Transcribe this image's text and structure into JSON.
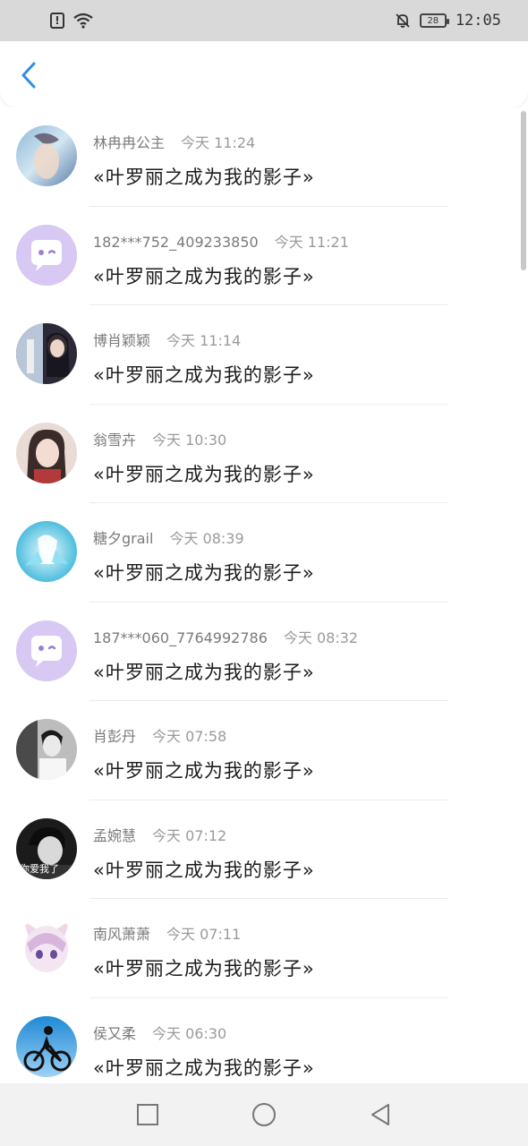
{
  "status_bar": {
    "battery": "28",
    "time": "12:05",
    "icons": [
      "alert-icon",
      "wifi-icon",
      "bell-off-icon",
      "battery-icon"
    ]
  },
  "header": {
    "back_icon": "chevron-left-icon",
    "accent": "#2d8ee8"
  },
  "comments": [
    {
      "username": "林冉冉公主",
      "time": "今天 11:24",
      "text": "«叶罗丽之成为我的影子»",
      "avatar": "photo-avatar"
    },
    {
      "username": "182***752_409233850",
      "time": "今天 11:21",
      "text": "«叶罗丽之成为我的影子»",
      "avatar": "default-chat-avatar"
    },
    {
      "username": "博肖颖颖",
      "time": "今天 11:14",
      "text": "«叶罗丽之成为我的影子»",
      "avatar": "photo-avatar"
    },
    {
      "username": "翁雪卉",
      "time": "今天 10:30",
      "text": "«叶罗丽之成为我的影子»",
      "avatar": "photo-avatar"
    },
    {
      "username": "糖夕grail",
      "time": "今天 08:39",
      "text": "«叶罗丽之成为我的影子»",
      "avatar": "photo-avatar"
    },
    {
      "username": "187***060_7764992786",
      "time": "今天 08:32",
      "text": "«叶罗丽之成为我的影子»",
      "avatar": "default-chat-avatar"
    },
    {
      "username": "肖彭丹",
      "time": "今天 07:58",
      "text": "«叶罗丽之成为我的影子»",
      "avatar": "photo-avatar"
    },
    {
      "username": "孟婉慧",
      "time": "今天 07:12",
      "text": "«叶罗丽之成为我的影子»",
      "avatar": "photo-avatar",
      "avatar_caption": "你爱我了"
    },
    {
      "username": "南风萧萧",
      "time": "今天 07:11",
      "text": "«叶罗丽之成为我的影子»",
      "avatar": "photo-avatar"
    },
    {
      "username": "侯又柔",
      "time": "今天 06:30",
      "text": "«叶罗丽之成为我的影子»",
      "avatar": "photo-avatar"
    }
  ],
  "nav_bar": {
    "buttons": [
      "recent-apps-icon",
      "home-icon",
      "back-icon"
    ]
  }
}
